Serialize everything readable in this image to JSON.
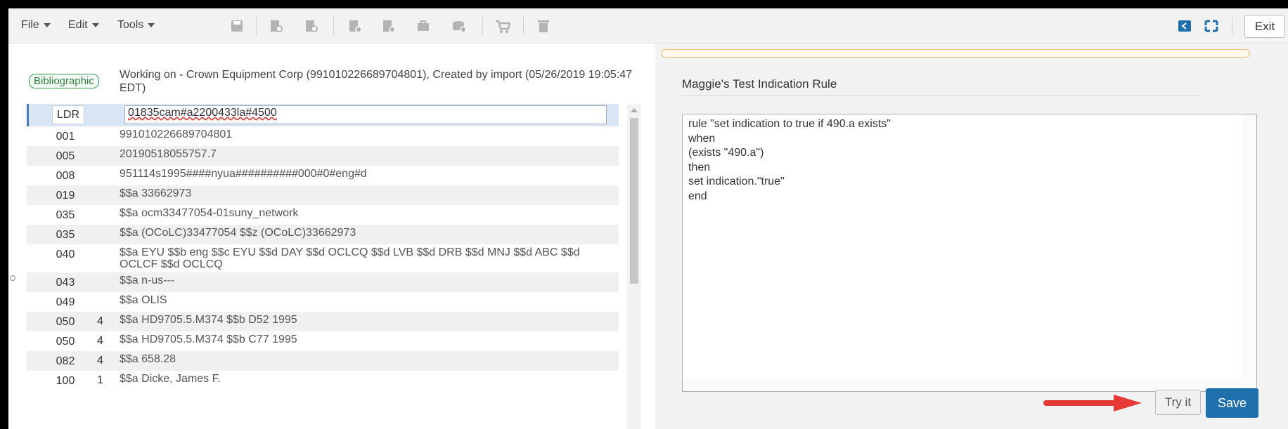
{
  "toolbar": {
    "file_label": "File",
    "edit_label": "Edit",
    "tools_label": "Tools",
    "exit_label": "Exit",
    "icons": [
      "save-icon",
      "record-search-icon",
      "record-find-icon",
      "add-record-icon",
      "add-holding-icon",
      "add-item-icon",
      "order-icon",
      "cart-icon",
      "delete-icon",
      "split-back-icon",
      "fullscreen-icon"
    ]
  },
  "record": {
    "badge": "Bibliographic",
    "working_on": "Working on - Crown Equipment Corp (991010226689704801), Created by import (05/26/2019 19:05:47 EDT)",
    "ldr_tag": "LDR",
    "ldr_value": "01835cam#a2200433la#4500",
    "fields": [
      {
        "tag": "001",
        "ind": "",
        "value": "991010226689704801"
      },
      {
        "tag": "005",
        "ind": "",
        "value": "20190518055757.7"
      },
      {
        "tag": "008",
        "ind": "",
        "value": "951114s1995####nyua##########000#0#eng#d"
      },
      {
        "tag": "019",
        "ind": "",
        "value": "$$a 33662973"
      },
      {
        "tag": "035",
        "ind": "",
        "value": "$$a ocm33477054-01suny_network"
      },
      {
        "tag": "035",
        "ind": "",
        "value": "$$a (OCoLC)33477054 $$z (OCoLC)33662973"
      },
      {
        "tag": "040",
        "ind": "",
        "value": "$$a EYU $$b eng $$c EYU $$d DAY $$d OCLCQ $$d LVB $$d DRB $$d MNJ $$d ABC $$d OCLCF $$d OCLCQ"
      },
      {
        "tag": "043",
        "ind": "",
        "value": "$$a n-us---"
      },
      {
        "tag": "049",
        "ind": "",
        "value": "$$a OLIS"
      },
      {
        "tag": "050",
        "ind": "4",
        "value": "$$a HD9705.5.M374 $$b D52 1995"
      },
      {
        "tag": "050",
        "ind": "4",
        "value": "$$a HD9705.5.M374 $$b C77 1995"
      },
      {
        "tag": "082",
        "ind": "4",
        "value": "$$a 658.28"
      },
      {
        "tag": "100",
        "ind": "1",
        "value": "$$a Dicke, James F."
      }
    ]
  },
  "rule": {
    "title": "Maggie's Test Indication Rule",
    "text": "rule \"set indication to true if 490.a exists\"\nwhen\n(exists \"490.a\")\nthen\nset indication.\"true\"\nend",
    "try_label": "Try it",
    "save_label": "Save"
  },
  "colors": {
    "save": "#1f6fad",
    "arrow": "#e53935",
    "badge": "#2e9d4c",
    "ldr_highlight": "#d9e6f7"
  }
}
